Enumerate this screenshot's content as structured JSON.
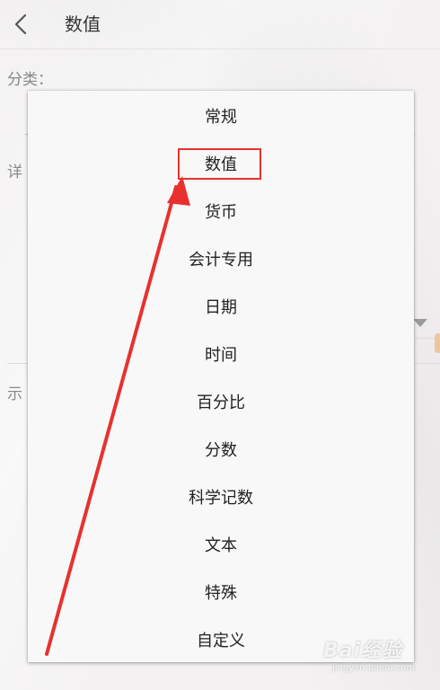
{
  "header": {
    "title": "数值",
    "back_icon": "chevron-left-icon"
  },
  "background_form": {
    "category_label": "分类：",
    "detail_label": "详",
    "example_label": "示"
  },
  "menu": {
    "items": [
      {
        "label": "常规"
      },
      {
        "label": "数值"
      },
      {
        "label": "货币"
      },
      {
        "label": "会计专用"
      },
      {
        "label": "日期"
      },
      {
        "label": "时间"
      },
      {
        "label": "百分比"
      },
      {
        "label": "分数"
      },
      {
        "label": "科学记数"
      },
      {
        "label": "文本"
      },
      {
        "label": "特殊"
      },
      {
        "label": "自定义"
      }
    ],
    "highlighted_item": "数值"
  },
  "annotation": {
    "highlight_color": "#e8312e",
    "arrow_color": "#e8312e"
  },
  "watermark": {
    "logo": "Bai经验",
    "url": "jingyan.baidu.com"
  }
}
